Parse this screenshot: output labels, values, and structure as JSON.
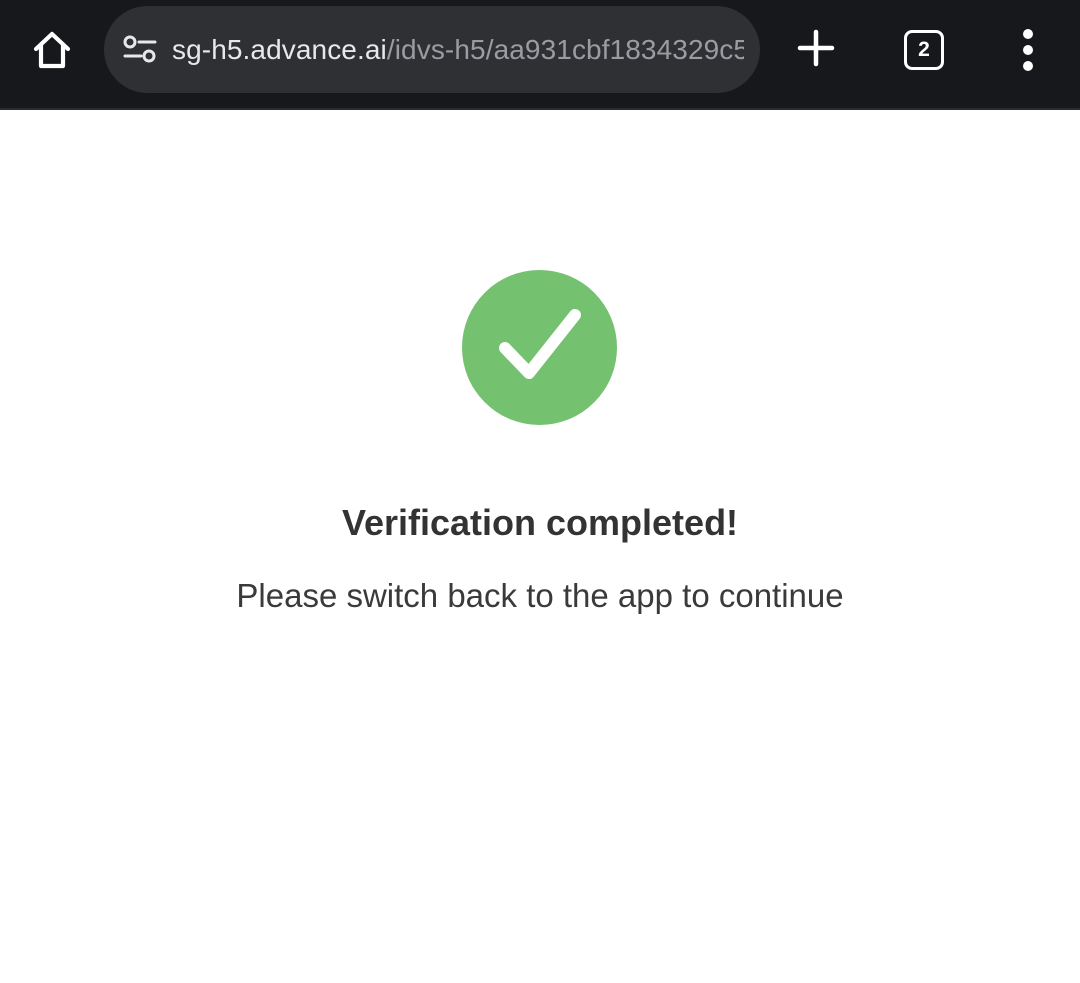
{
  "browser": {
    "url_host": "sg-h5.advance.ai",
    "url_path": "/idvs-h5/aa931cbf1834329c5",
    "tab_count": "2",
    "icons": {
      "home": "home-icon",
      "site_info": "site-info-icon",
      "new_tab": "plus-icon",
      "tabs": "tab-switcher-icon",
      "menu": "more-vert-icon"
    }
  },
  "page": {
    "status_icon": "check-circle-icon",
    "title": "Verification completed!",
    "subtitle": "Please switch back to the app to continue"
  },
  "colors": {
    "toolbar_bg": "#17181c",
    "omnibox_bg": "#2f3034",
    "success_green": "#74c16f",
    "text_dark": "#333333"
  }
}
